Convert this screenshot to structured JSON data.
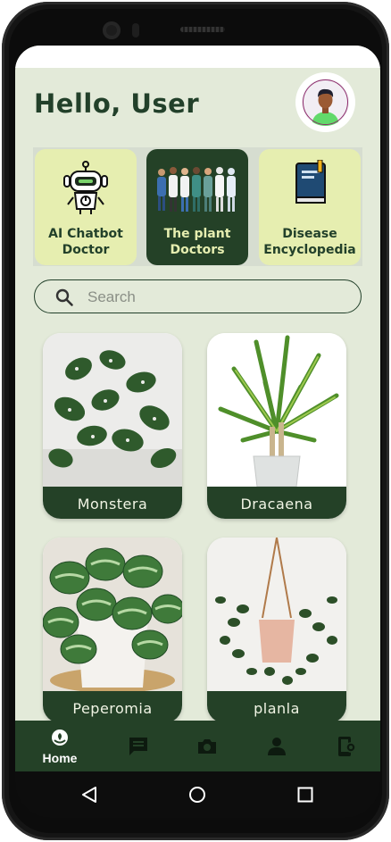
{
  "header": {
    "greeting": "Hello, User"
  },
  "feature_cards": [
    {
      "label": "AI Chatbot Doctor",
      "icon": "robot-icon",
      "selected": false
    },
    {
      "label": "The plant Doctors",
      "icon": "doctors-group-icon",
      "selected": true
    },
    {
      "label": "Disease Encyclopedia",
      "icon": "book-icon",
      "selected": false
    }
  ],
  "search": {
    "placeholder": "Search",
    "value": ""
  },
  "plants": [
    {
      "name": "Monstera"
    },
    {
      "name": "Dracaena"
    },
    {
      "name": "Peperomia"
    },
    {
      "name": "planla"
    }
  ],
  "bottom_nav": [
    {
      "label": "Home",
      "icon": "plant-home-icon",
      "active": true
    },
    {
      "label": "",
      "icon": "chat-icon",
      "active": false
    },
    {
      "label": "",
      "icon": "camera-icon",
      "active": false
    },
    {
      "label": "",
      "icon": "person-icon",
      "active": false
    },
    {
      "label": "",
      "icon": "device-settings-icon",
      "active": false
    }
  ],
  "colors": {
    "primary": "#244127",
    "background": "#e3ead9",
    "card_light": "#e6eeb0"
  }
}
